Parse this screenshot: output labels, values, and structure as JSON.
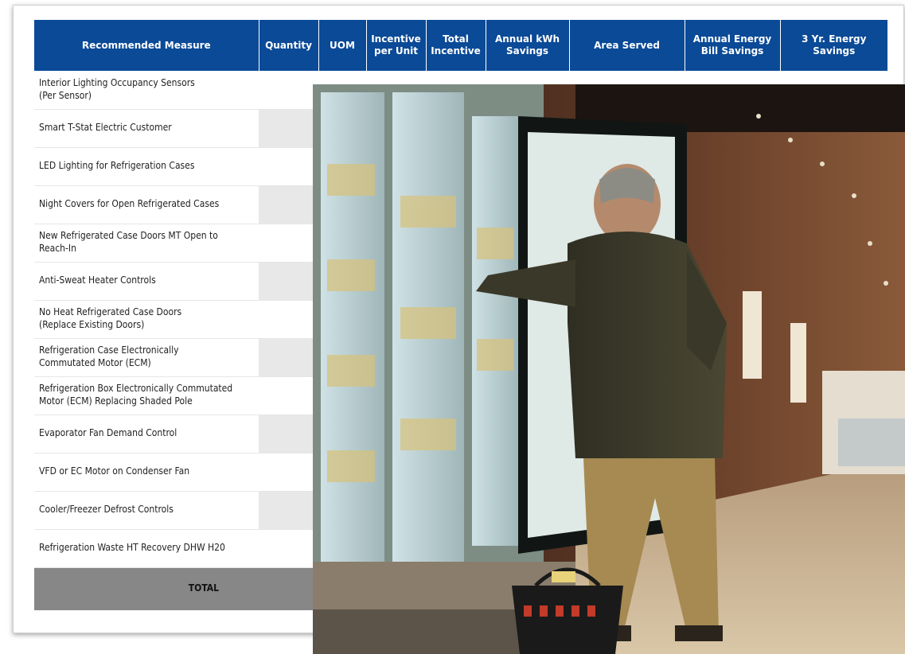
{
  "table": {
    "headers": [
      "Recommended Measure",
      "Quantity",
      "UOM",
      "Incentive per Unit",
      "Total Incentive",
      "Annual kWh Savings",
      "Area Served",
      "Annual Energy Bill Savings",
      "3 Yr. Energy Savings"
    ],
    "rows": [
      "Interior Lighting Occupancy Sensors\n(Per Sensor)",
      "Smart T-Stat Electric Customer",
      "LED Lighting for Refrigeration Cases",
      "Night Covers for Open Refrigerated Cases",
      "New Refrigerated Case Doors MT Open to\nReach-In",
      "Anti-Sweat Heater Controls",
      "No Heat Refrigerated Case Doors\n(Replace Existing Doors)",
      "Refrigeration Case Electronically\nCommutated Motor (ECM)",
      "Refrigeration Box Electronically Commutated\nMotor (ECM) Replacing Shaded Pole",
      "Evaporator Fan Demand Control",
      "VFD or EC Motor on Condenser Fan",
      "Cooler/Freezer Defrost Controls",
      "Refrigeration Waste HT Recovery DHW H20"
    ],
    "total_label": "TOTAL"
  },
  "colors": {
    "header_blue": "#0a4a97",
    "total_gray": "#878787",
    "stripe_gray": "#e8e8e8"
  }
}
